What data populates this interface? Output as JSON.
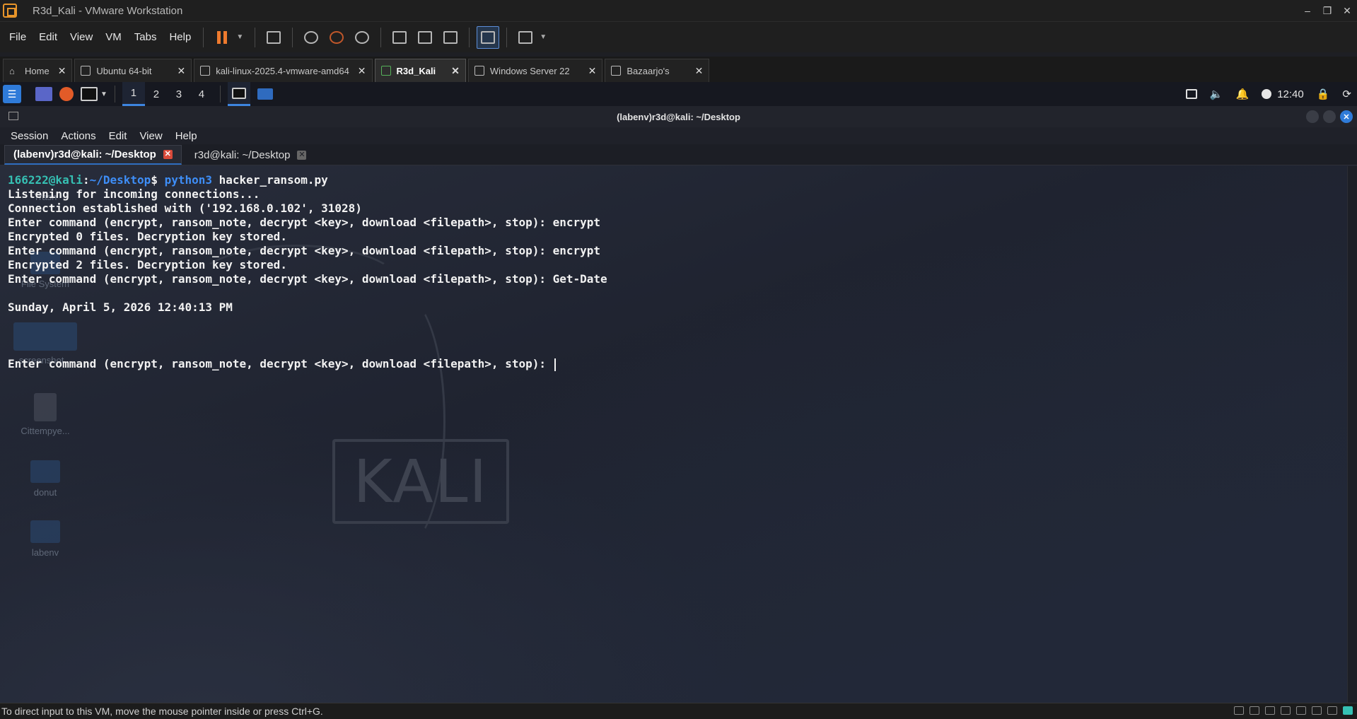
{
  "window": {
    "title": "R3d_Kali - VMware Workstation"
  },
  "menu": [
    "File",
    "Edit",
    "View",
    "VM",
    "Tabs",
    "Help"
  ],
  "vm_tabs": [
    {
      "label": "Home",
      "active": false
    },
    {
      "label": "Ubuntu 64-bit",
      "active": false
    },
    {
      "label": "kali-linux-2025.4-vmware-amd64",
      "active": false
    },
    {
      "label": "R3d_Kali",
      "active": true
    },
    {
      "label": "Windows Server 22",
      "active": false
    },
    {
      "label": "Bazaarjo's",
      "active": false
    }
  ],
  "guest_panel": {
    "workspaces": [
      "1",
      "2",
      "3",
      "4"
    ],
    "active_workspace": "1",
    "clock": "12:40"
  },
  "desktop_icons": [
    "Trash",
    "File System",
    "screenshot...",
    "Cittempye...",
    "donut",
    "labenv"
  ],
  "terminal": {
    "title": "(labenv)r3d@kali: ~/Desktop",
    "menu": [
      "Session",
      "Actions",
      "Edit",
      "View",
      "Help"
    ],
    "tabs": [
      {
        "label": "(labenv)r3d@kali: ~/Desktop",
        "active": true
      },
      {
        "label": "r3d@kali: ~/Desktop",
        "active": false
      }
    ],
    "prompt_user": "166222@kali",
    "prompt_sep": ":",
    "prompt_path": "~/Desktop",
    "prompt_dollar": "$ ",
    "prompt_cmd": "python3",
    "prompt_args": " hacker_ransom.py",
    "lines": [
      "Listening for incoming connections...",
      "Connection established with ('192.168.0.102', 31028)",
      "Enter command (encrypt, ransom_note, decrypt <key>, download <filepath>, stop): encrypt",
      "Encrypted 0 files. Decryption key stored.",
      "Enter command (encrypt, ransom_note, decrypt <key>, download <filepath>, stop): encrypt",
      "Encrypted 2 files. Decryption key stored.",
      "Enter command (encrypt, ransom_note, decrypt <key>, download <filepath>, stop): Get-Date",
      "",
      "Sunday, April 5, 2026 12:40:13 PM",
      "",
      "",
      "",
      "Enter command (encrypt, ransom_note, decrypt <key>, download <filepath>, stop): "
    ]
  },
  "kali_logo_text": "KALI",
  "status_bar": {
    "text": "To direct input to this VM, move the mouse pointer inside or press Ctrl+G."
  }
}
